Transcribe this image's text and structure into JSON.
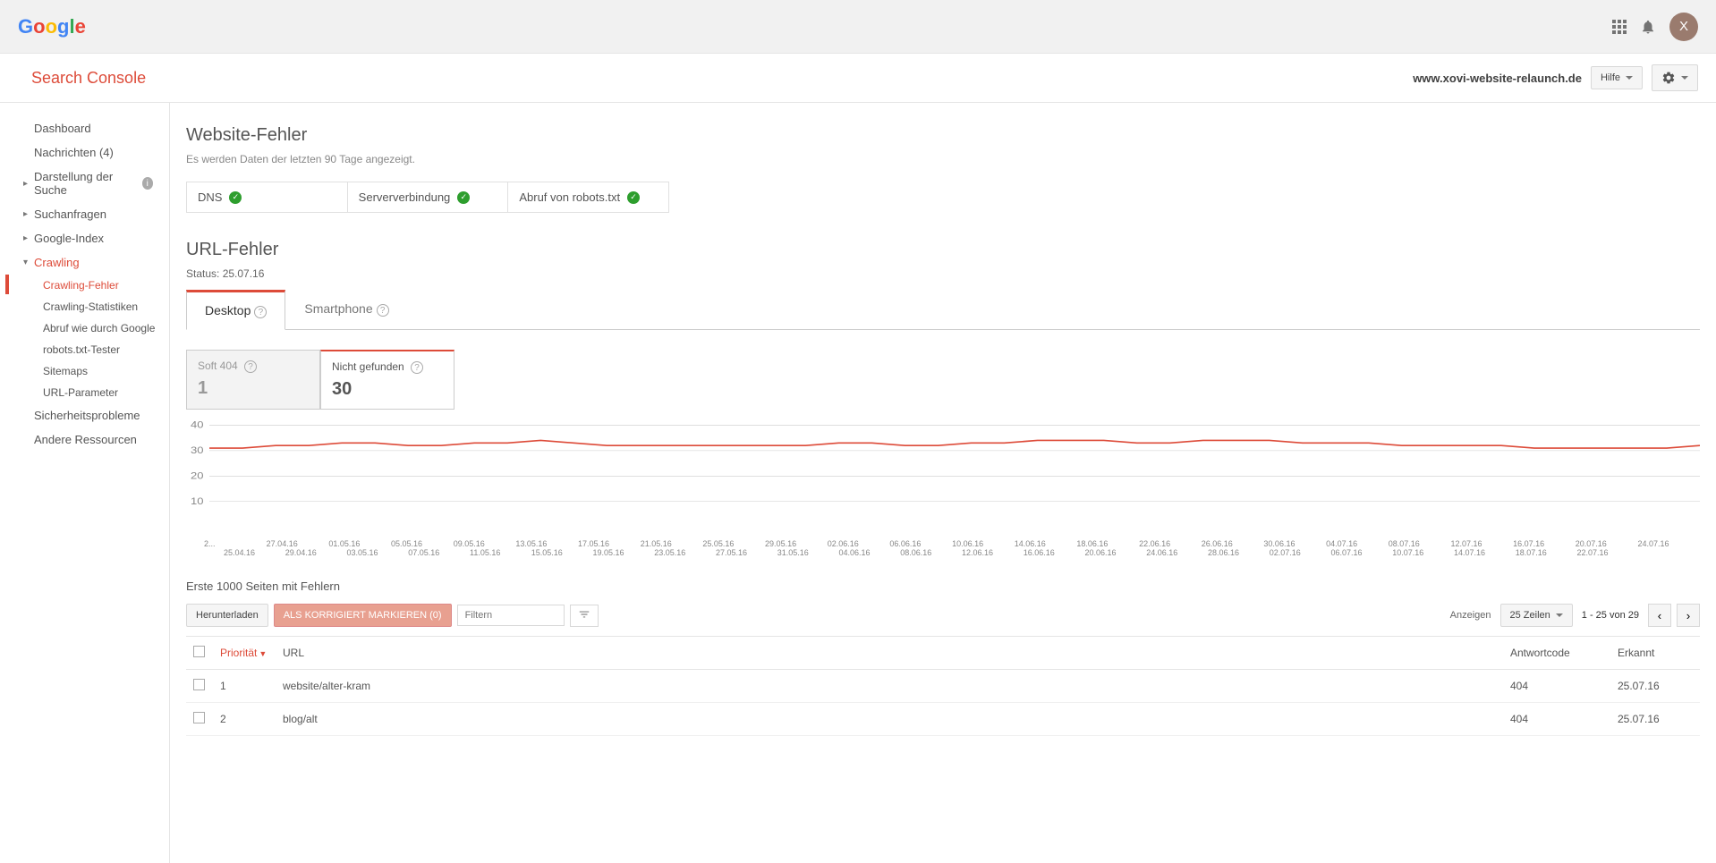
{
  "topbar": {
    "avatar_letter": "X"
  },
  "header": {
    "product": "Search Console",
    "domain": "www.xovi-website-relaunch.de",
    "help_label": "Hilfe"
  },
  "sidebar": {
    "items": [
      {
        "label": "Dashboard"
      },
      {
        "label": "Nachrichten (4)"
      },
      {
        "label": "Darstellung der Suche",
        "caret": true,
        "info": true
      },
      {
        "label": "Suchanfragen",
        "caret": true
      },
      {
        "label": "Google-Index",
        "caret": true
      },
      {
        "label": "Crawling",
        "caret": true,
        "expanded": true,
        "red": true
      },
      {
        "label": "Sicherheitsprobleme"
      },
      {
        "label": "Andere Ressourcen"
      }
    ],
    "crawling_children": [
      "Crawling-Fehler",
      "Crawling-Statistiken",
      "Abruf wie durch Google",
      "robots.txt-Tester",
      "Sitemaps",
      "URL-Parameter"
    ]
  },
  "site_errors": {
    "title": "Website-Fehler",
    "subtitle": "Es werden Daten der letzten 90 Tage angezeigt.",
    "boxes": [
      "DNS",
      "Serververbindung",
      "Abruf von robots.txt"
    ]
  },
  "url_errors": {
    "title": "URL-Fehler",
    "status_line": "Status: 25.07.16",
    "tabs": [
      "Desktop",
      "Smartphone"
    ],
    "types": [
      {
        "label": "Soft 404",
        "count": "1",
        "active": false
      },
      {
        "label": "Nicht gefunden",
        "count": "30",
        "active": true
      }
    ]
  },
  "chart_data": {
    "type": "line",
    "ylabel": "",
    "ylim": [
      0,
      40
    ],
    "yticks": [
      10,
      20,
      30,
      40
    ],
    "x": [
      "25.04.16",
      "27.04.16",
      "29.04.16",
      "01.05.16",
      "03.05.16",
      "05.05.16",
      "07.05.16",
      "09.05.16",
      "11.05.16",
      "13.05.16",
      "15.05.16",
      "17.05.16",
      "19.05.16",
      "21.05.16",
      "23.05.16",
      "25.05.16",
      "27.05.16",
      "29.05.16",
      "31.05.16",
      "02.06.16",
      "04.06.16",
      "06.06.16",
      "08.06.16",
      "10.06.16",
      "12.06.16",
      "14.06.16",
      "16.06.16",
      "18.06.16",
      "20.06.16",
      "22.06.16",
      "24.06.16",
      "26.06.16",
      "28.06.16",
      "30.06.16",
      "02.07.16",
      "04.07.16",
      "06.07.16",
      "08.07.16",
      "10.07.16",
      "12.07.16",
      "14.07.16",
      "16.07.16",
      "18.07.16",
      "20.07.16",
      "22.07.16",
      "24.07.16"
    ],
    "values": [
      31,
      31,
      32,
      32,
      33,
      33,
      32,
      32,
      33,
      33,
      34,
      33,
      32,
      32,
      32,
      32,
      32,
      32,
      32,
      33,
      33,
      32,
      32,
      33,
      33,
      34,
      34,
      34,
      33,
      33,
      34,
      34,
      34,
      33,
      33,
      33,
      32,
      32,
      32,
      32,
      31,
      31,
      31,
      31,
      31,
      32
    ],
    "xlabel_row1": [
      "2...",
      "27.04.16",
      "01.05.16",
      "05.05.16",
      "09.05.16",
      "13.05.16",
      "17.05.16",
      "21.05.16",
      "25.05.16",
      "29.05.16",
      "02.06.16",
      "06.06.16",
      "10.06.16",
      "14.06.16",
      "18.06.16",
      "22.06.16",
      "26.06.16",
      "30.06.16",
      "04.07.16",
      "08.07.16",
      "12.07.16",
      "16.07.16",
      "20.07.16",
      "24.07.16"
    ],
    "xlabel_row2": [
      "25.04.16",
      "29.04.16",
      "03.05.16",
      "07.05.16",
      "11.05.16",
      "15.05.16",
      "19.05.16",
      "23.05.16",
      "27.05.16",
      "31.05.16",
      "04.06.16",
      "08.06.16",
      "12.06.16",
      "16.06.16",
      "20.06.16",
      "24.06.16",
      "28.06.16",
      "02.07.16",
      "06.07.16",
      "10.07.16",
      "14.07.16",
      "18.07.16",
      "22.07.16",
      ""
    ]
  },
  "table": {
    "title": "Erste 1000 Seiten mit Fehlern",
    "download": "Herunterladen",
    "mark_fixed": "ALS KORRIGIERT MARKIEREN (0)",
    "filter_placeholder": "Filtern",
    "show_label": "Anzeigen",
    "rows_per_page": "25 Zeilen",
    "pager_text": "1 - 25 von 29",
    "headers": [
      "Priorität",
      "URL",
      "Antwortcode",
      "Erkannt"
    ],
    "rows": [
      {
        "priority": "1",
        "url": "website/alter-kram",
        "code": "404",
        "detected": "25.07.16"
      },
      {
        "priority": "2",
        "url": "blog/alt",
        "code": "404",
        "detected": "25.07.16"
      }
    ]
  }
}
